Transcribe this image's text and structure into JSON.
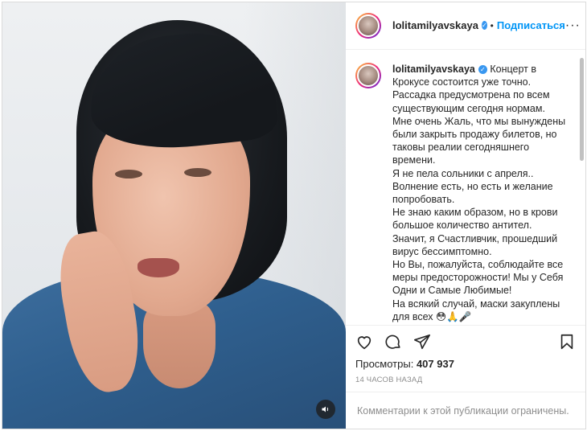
{
  "post": {
    "username": "lolitamilyavskaya",
    "follow_label": "Подписаться",
    "more_label": "···",
    "dot": "•",
    "caption": "Концерт в Крокусе состоится уже точно.\nРассадка предусмотрена по всем существующим сегодня нормам.\nМне очень Жаль, что мы вынуждены были закрыть продажу билетов, но таковы реалии сегодняшнего времени.\nЯ не пела сольники с апреля..\nВолнение есть, но есть и желание попробовать.\nНе знаю каким образом, но в крови большое количество антител.\nЗначит, я Счастливчик, прошедший вирус бессимптомно.\nНо Вы, пожалуйста, соблюдайте все меры предосторожности! Мы у Себя Одни и Самые Любимые!\nНа всякий случай, маски закуплены для всех 😳🙏🎤",
    "views_label": "Просмотры:",
    "views_count": "407 937",
    "time": "14 ЧАСОВ НАЗАД",
    "comments_disabled": "Комментарии к этой публикации ограничены."
  },
  "icons": {
    "like": "heart-icon",
    "comment": "comment-icon",
    "share": "share-icon",
    "save": "bookmark-icon",
    "audio": "speaker-icon",
    "verified": "verified-badge-icon"
  },
  "colors": {
    "link": "#0095f6",
    "verified": "#3897f0",
    "muted": "#8e8e8e",
    "text": "#262626"
  }
}
